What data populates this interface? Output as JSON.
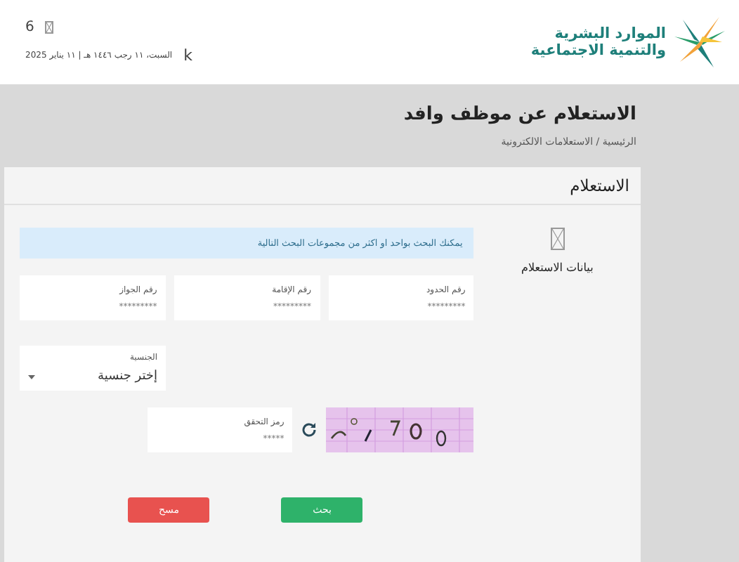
{
  "header": {
    "counter": "6",
    "date": "السبت، ١١ رجب ١٤٤٦ هـ | ١١ يناير 2025",
    "user_initial": "k",
    "logo": {
      "line_1": "الموارد البشرية",
      "line_2": "والتنمية الاجتماعية"
    }
  },
  "page": {
    "title": "الاستعلام عن موظف وافد",
    "breadcrumb": "الرئيسية / الاستعلامات الالكترونية"
  },
  "card": {
    "title": "الاستعلام",
    "section_label": "بيانات الاستعلام",
    "notice": "يمكنك البحث بواحد او اكثر من مجموعات البحث التالية",
    "fields": [
      {
        "label": "رقم الحدود",
        "placeholder": "*********"
      },
      {
        "label": "رقم الإقامة",
        "placeholder": "*********"
      },
      {
        "label": "رقم الجواز",
        "placeholder": "*********"
      }
    ],
    "nationality": {
      "label": "الجنسية",
      "value": "إختر جنسية"
    },
    "captcha": {
      "label": "رمز التحقق",
      "placeholder": "*****"
    },
    "buttons": [
      {
        "label": "بحث",
        "kind": "primary"
      },
      {
        "label": "مسح",
        "kind": "danger"
      }
    ]
  }
}
